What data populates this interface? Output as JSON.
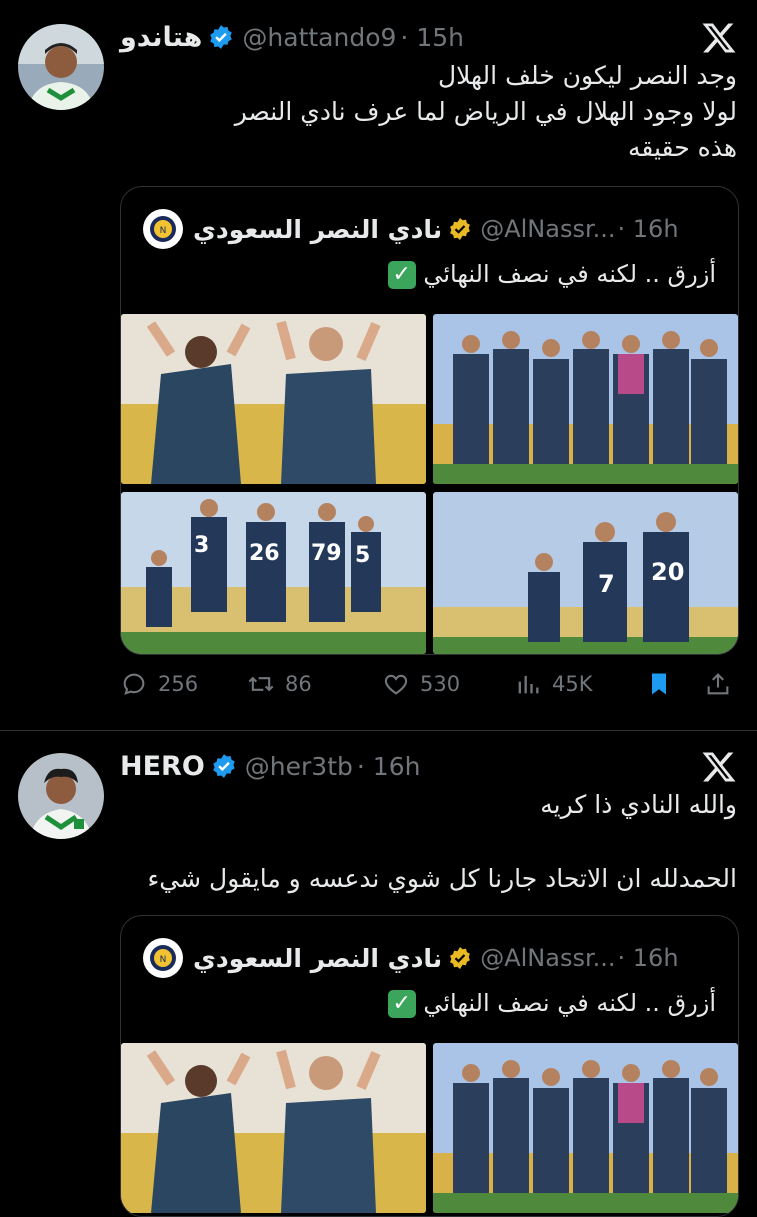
{
  "tweets": [
    {
      "name": "هتاندو",
      "handle": "@hattando9",
      "time": "· 15h",
      "lines": [
        "وجد النصر ليكون خلف الهلال",
        "لولا وجود الهلال في الرياض لما عرف نادي النصر",
        "هذه حقيقه"
      ],
      "quote": {
        "name": "نادي النصر السعودي",
        "handle": "@AlNassr...",
        "time": "· 16h",
        "text": "أزرق .. لكنه في نصف النهائي"
      },
      "actions": {
        "replies": "256",
        "reposts": "86",
        "likes": "530",
        "views": "45K"
      }
    },
    {
      "name": "HERO",
      "handle": "@her3tb",
      "time": "· 16h",
      "lines": [
        "والله النادي ذا كريه",
        "",
        "الحمدلله ان الاتحاد جارنا كل شوي ندعسه و مايقول شيء"
      ],
      "quote": {
        "name": "نادي النصر السعودي",
        "handle": "@AlNassr...",
        "time": "· 16h",
        "text": "أزرق .. لكنه في نصف النهائي"
      }
    }
  ],
  "icons": {
    "verified": "verified-badge-icon",
    "x_logo": "x-logo-icon",
    "reply": "reply-icon",
    "repost": "repost-icon",
    "like": "like-icon",
    "views": "views-icon",
    "bookmark": "bookmark-icon",
    "share": "share-icon"
  },
  "colors": {
    "background": "#000000",
    "text": "#e7e9ea",
    "muted": "#71767b",
    "accent": "#1d9bf0",
    "gold": "#e8b923",
    "border": "#2f3336"
  }
}
